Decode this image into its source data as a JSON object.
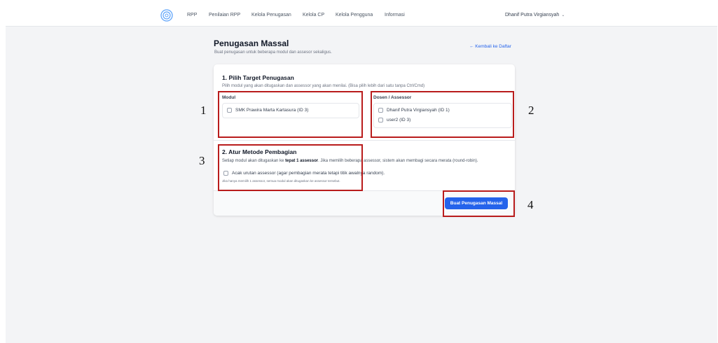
{
  "nav": {
    "items": [
      "RPP",
      "Penilaian RPP",
      "Kelola Penugasan",
      "Kelola CP",
      "Kelola Pengguna",
      "Informasi"
    ],
    "user": "Dhanif Putra Virgiansyah",
    "user_chevron": "⌄"
  },
  "page": {
    "title": "Penugasan Massal",
    "subtitle": "Buat penugasan untuk beberapa modul dan assesor sekaligus.",
    "back_link": "← Kembali ke Daftar"
  },
  "section1": {
    "title": "1. Pilih Target Penugasan",
    "description": "Pilih modul yang akan ditugaskan dan assessor yang akan menilai. (Bisa pilih lebih dari satu tanpa Ctrl/Cmd)",
    "modul_label": "Modul",
    "modul_options": [
      "SMK Prawira Marta Kartasura (ID 3)"
    ],
    "assessor_label": "Dosen / Assessor",
    "assessor_options": [
      "Dhanif Putra Virgiansyah (ID 1)",
      "user2 (ID 3)"
    ]
  },
  "section2": {
    "title": "2. Atur Metode Pembagian",
    "desc_before": "Setiap modul akan ditugaskan ke ",
    "desc_bold": "tepat 1 assessor",
    "desc_after": ". Jika memilih beberapa assessor, sistem akan membagi secara merata (round-robin).",
    "checkbox_label": "Acak urutan assessor (agar pembagian merata tetapi titik awalnya random).",
    "note": "Jika hanya memilih 1 assessor, semua modul akan ditugaskan ke assessor tersebut."
  },
  "submit_label": "Buat Penugasan Massal",
  "annotations": [
    "1",
    "2",
    "3",
    "4"
  ],
  "colors": {
    "primary": "#2563eb",
    "annotation": "#b91c1c",
    "background": "#f3f4f6"
  },
  "icons": {
    "logo": "logo-icon",
    "chevron": "chevron-down-icon",
    "back": "arrow-left-icon"
  }
}
